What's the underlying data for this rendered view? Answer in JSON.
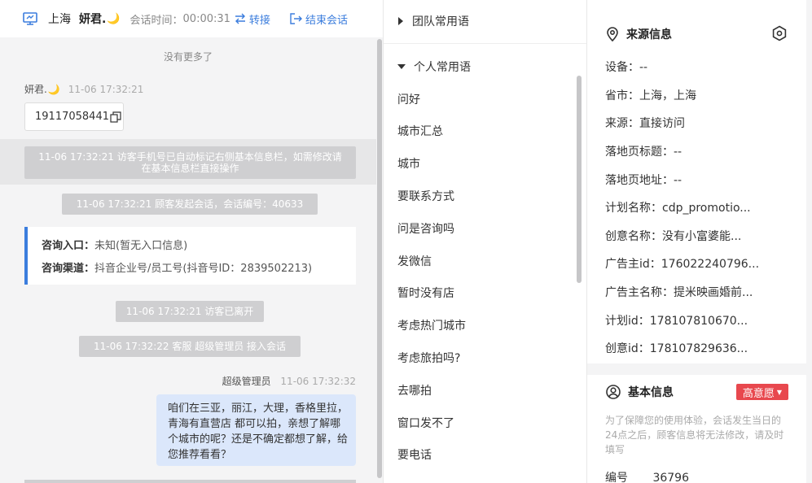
{
  "header": {
    "city": "上海",
    "user_name": "妍君.",
    "moon_glyph": "🌙",
    "session_time_label": "会话时间：",
    "session_time": "00:00:31",
    "transfer_label": "转接",
    "end_label": "结束会话"
  },
  "chat": {
    "no_more": "没有更多了",
    "visitor_name": "妍君.",
    "visitor_time": "11-06 17:32:21",
    "phone": "19117058441",
    "sys_msg_1": "11-06 17:32:21 访客手机号已自动标记右侧基本信息栏，如需修改请在基本信息栏直接操作",
    "sys_msg_2": "11-06 17:32:21 顾客发起会话，会话编号：40633",
    "entry_label": "咨询入口：",
    "entry_value": "未知(暂无入口信息)",
    "channel_label": "咨询渠道：",
    "channel_value": "抖音企业号/员工号(抖音号ID：2839502213)",
    "sys_msg_3": "11-06 17:32:21 访客已离开",
    "sys_msg_4": "11-06 17:32:22 客服 超级管理员 接入会话",
    "agent_name": "超级管理员",
    "agent_time": "11-06 17:32:32",
    "agent_message": "咱们在三亚，丽江，大理，香格里拉，青海有直营店 都可以拍，亲想了解哪个城市的呢？还是不确定都想了解，给您推荐看看？"
  },
  "phrases": {
    "team_group": "团队常用语",
    "personal_group": "个人常用语",
    "items": [
      "问好",
      "城市汇总",
      "城市",
      "要联系方式",
      "问是咨询吗",
      "发微信",
      "暂时没有店",
      "考虑热门城市",
      "考虑旅拍吗?",
      "去哪拍",
      "窗口发不了",
      "要电话"
    ]
  },
  "info": {
    "source_title": "来源信息",
    "fields": [
      "设备：--",
      "省市：上海，上海",
      "来源：直接访问",
      "落地页标题：--",
      "落地页地址：--",
      "计划名称：cdp_promotio...",
      "创意名称：没有小富婆能...",
      "广告主id：176022240796...",
      "广告主名称：提米映画婚前...",
      "计划id：178107810670...",
      "创意id：178107829636..."
    ],
    "basic_title": "基本信息",
    "intent_label": "高意愿",
    "notice": "为了保障您的使用体验，会话发生当日的24点之后，顾客信息将无法修改，请及时填写",
    "id_label": "编号",
    "id_value": "36796"
  },
  "colors": {
    "accent": "#3b7ddd",
    "intent_badge": "#e8484e",
    "agent_bubble": "#dbe7fb"
  }
}
